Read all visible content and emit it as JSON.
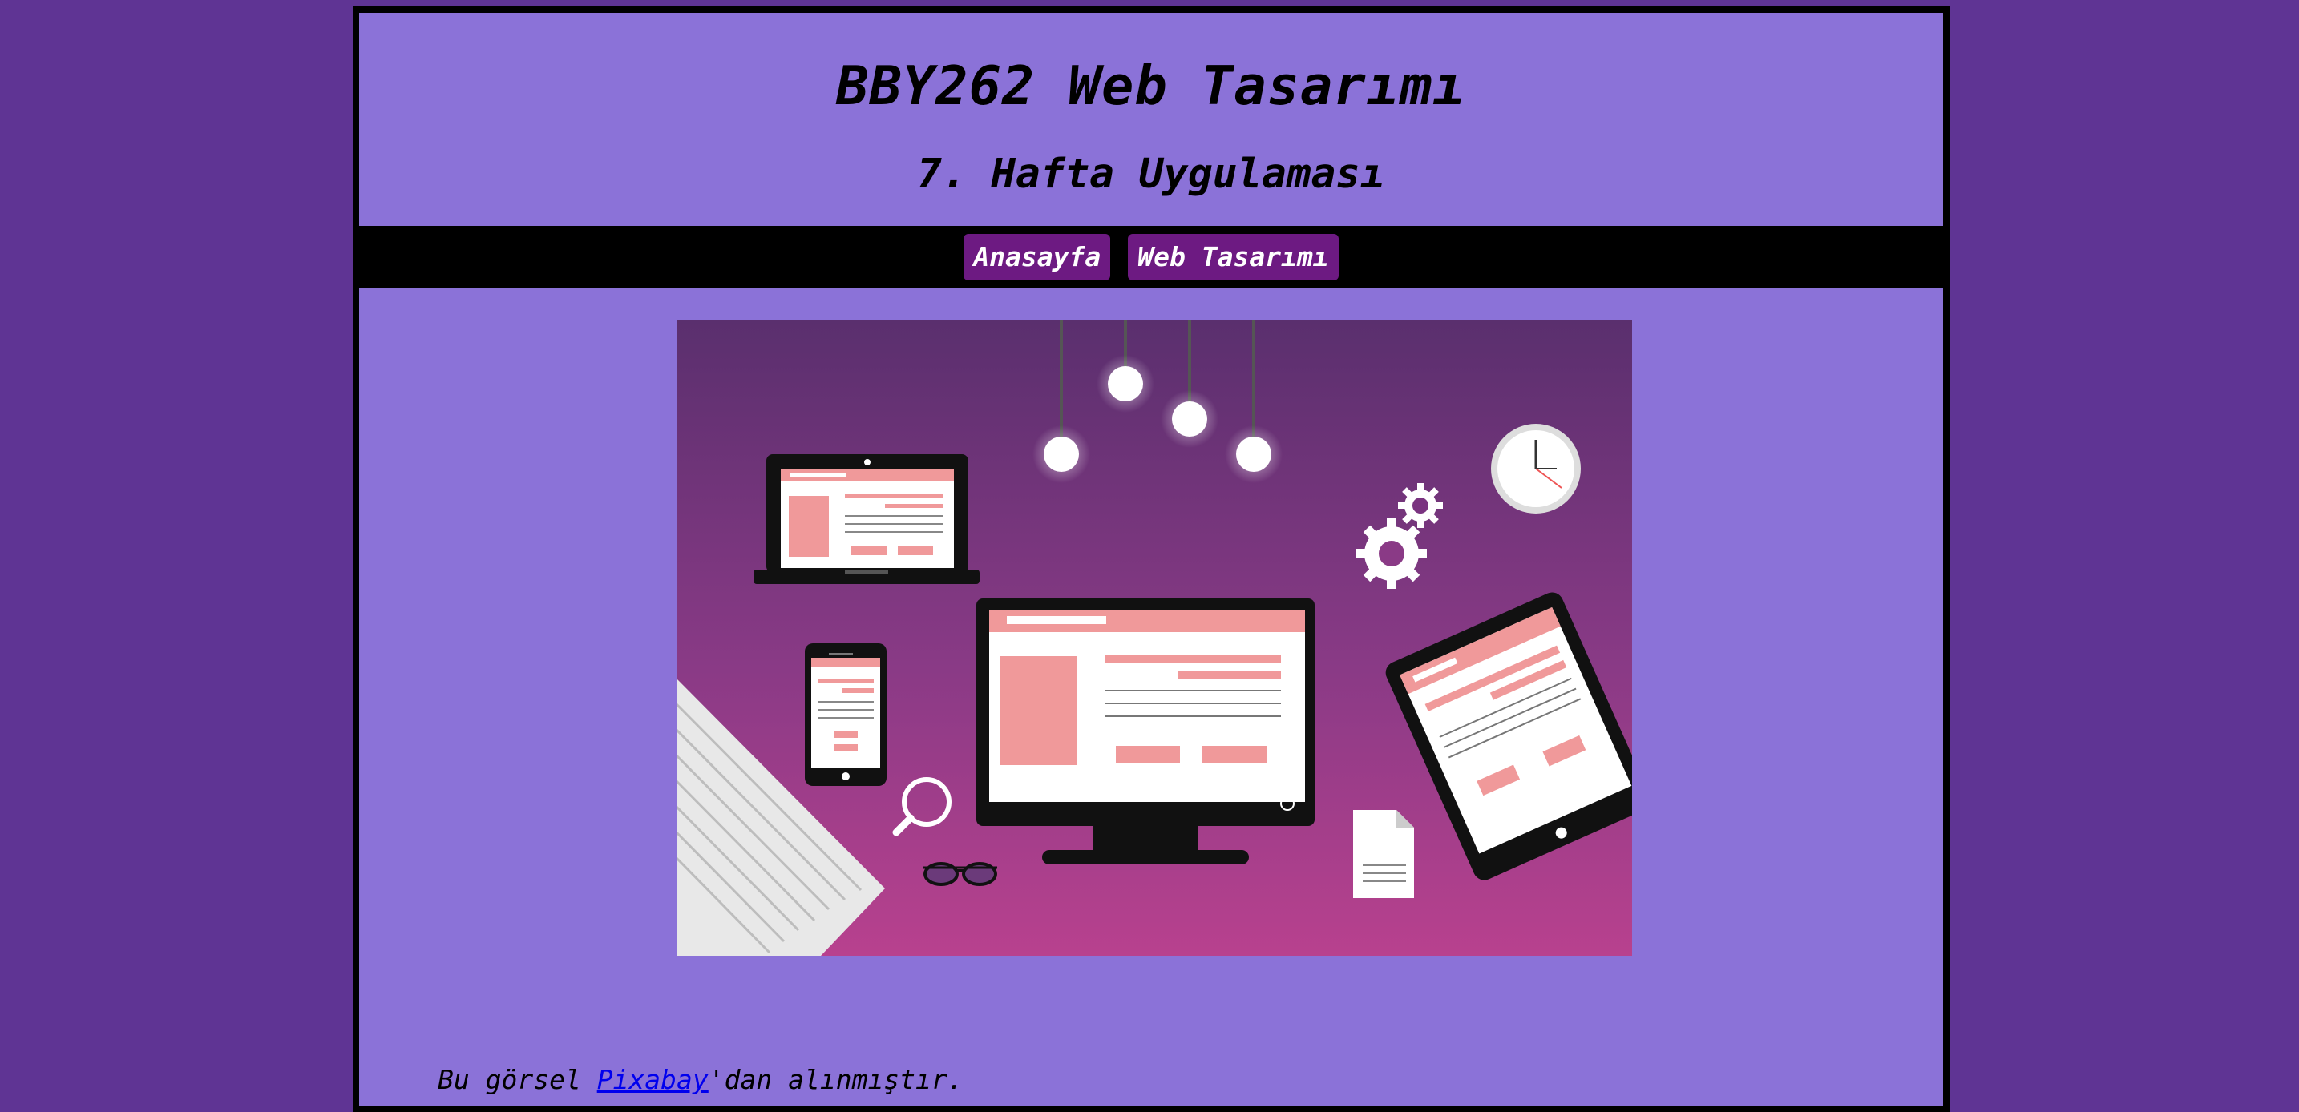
{
  "header": {
    "title": "BBY262 Web Tasarımı",
    "subtitle": "7. Hafta Uygulaması"
  },
  "nav": {
    "items": [
      {
        "label": "Anasayfa"
      },
      {
        "label": "Web Tasarımı"
      }
    ]
  },
  "credit": {
    "prefix": "Bu görsel ",
    "link_label": "Pixabay",
    "suffix": "'dan alınmıştır."
  },
  "colors": {
    "page_background": "#5f3494",
    "content_background": "#8b72d8",
    "nav_bar": "#000000",
    "nav_button": "#6d1a82",
    "link": "#0000ee"
  },
  "hero_image": {
    "subject": "responsive web design illustration"
  }
}
